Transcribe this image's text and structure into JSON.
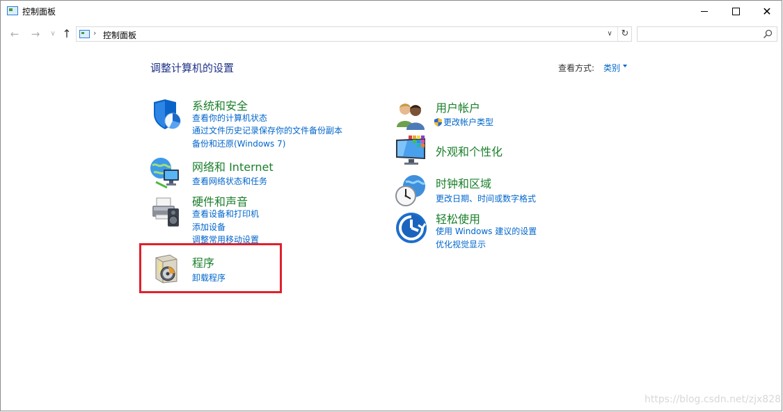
{
  "window": {
    "title": "控制面板",
    "minimize_icon": "minimize-icon",
    "maximize_icon": "maximize-icon",
    "close_icon": "close-icon",
    "close_glyph": "✕"
  },
  "nav": {
    "back_glyph": "←",
    "forward_glyph": "→",
    "recent_glyph": "∨",
    "up_glyph": "↑",
    "breadcrumb_sep": "›",
    "breadcrumb": "控制面板",
    "dropdown_glyph": "∨",
    "refresh_glyph": "↻",
    "search_placeholder": ""
  },
  "main": {
    "title": "调整计算机的设置",
    "view_by_label": "查看方式:",
    "view_by_value": "类别"
  },
  "categories_left": [
    {
      "title": "系统和安全",
      "icon": "shield-pie-icon",
      "links": [
        "查看你的计算机状态",
        "通过文件历史记录保存你的文件备份副本",
        "备份和还原(Windows 7)"
      ]
    },
    {
      "title": "网络和 Internet",
      "icon": "network-globe-icon",
      "links": [
        "查看网络状态和任务"
      ]
    },
    {
      "title": "硬件和声音",
      "icon": "printer-speaker-icon",
      "links": [
        "查看设备和打印机",
        "添加设备",
        "调整常用移动设置"
      ]
    },
    {
      "title": "程序",
      "icon": "programs-disc-icon",
      "links": [
        "卸载程序"
      ]
    }
  ],
  "categories_right": [
    {
      "title": "用户帐户",
      "icon": "users-icon",
      "links": [
        "更改帐户类型"
      ]
    },
    {
      "title": "外观和个性化",
      "icon": "monitor-colors-icon",
      "links": []
    },
    {
      "title": "时钟和区域",
      "icon": "clock-globe-icon",
      "links": [
        "更改日期、时间或数字格式"
      ]
    },
    {
      "title": "轻松使用",
      "icon": "ease-of-access-icon",
      "links": [
        "使用 Windows 建议的设置",
        "优化视觉显示"
      ]
    }
  ],
  "watermark": "https://blog.csdn.net/zjx828",
  "colors": {
    "category_title": "#1a7f2a",
    "link": "#0066cc",
    "page_title": "#1e3287",
    "highlight": "#e0202b"
  }
}
